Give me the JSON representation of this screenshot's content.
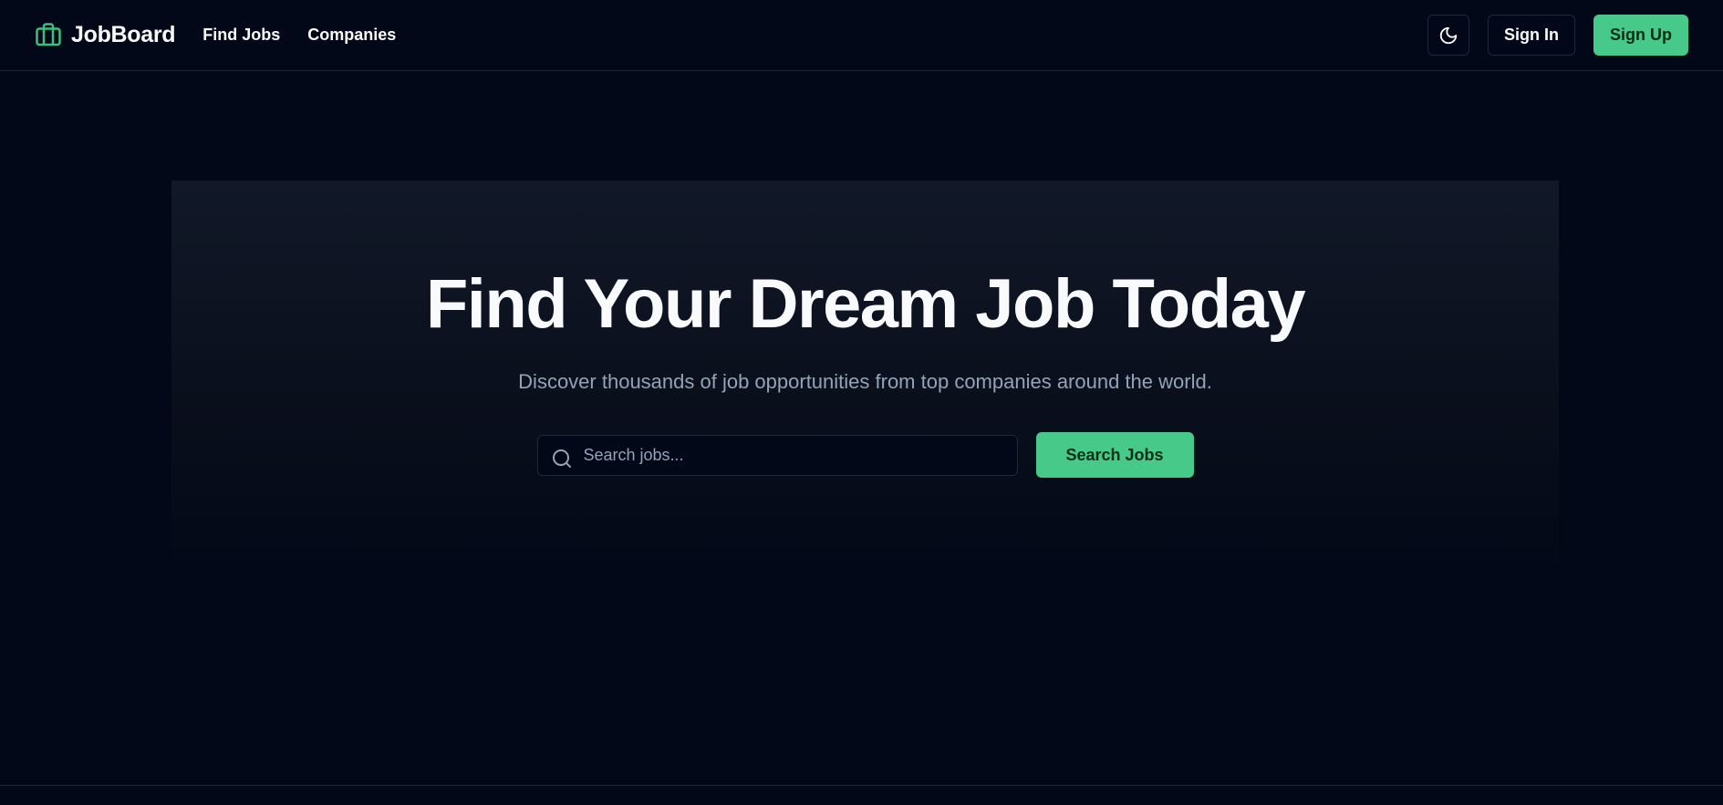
{
  "navbar": {
    "brand_name": "JobBoard",
    "brand_icon": "briefcase-icon",
    "links": [
      {
        "label": "Find Jobs"
      },
      {
        "label": "Companies"
      }
    ],
    "theme_toggle_icon": "moon-icon",
    "sign_in_label": "Sign In",
    "sign_up_label": "Sign Up"
  },
  "hero": {
    "title": "Find Your Dream Job Today",
    "subtitle": "Discover thousands of job opportunities from top companies around the world.",
    "search": {
      "placeholder": "Search jobs...",
      "value": "",
      "icon": "search-icon",
      "button_label": "Search Jobs"
    }
  },
  "colors": {
    "background": "#020817",
    "accent": "#47c98a",
    "border": "#1e293b",
    "muted_text": "#94a3b8",
    "text": "#f8fafc"
  }
}
